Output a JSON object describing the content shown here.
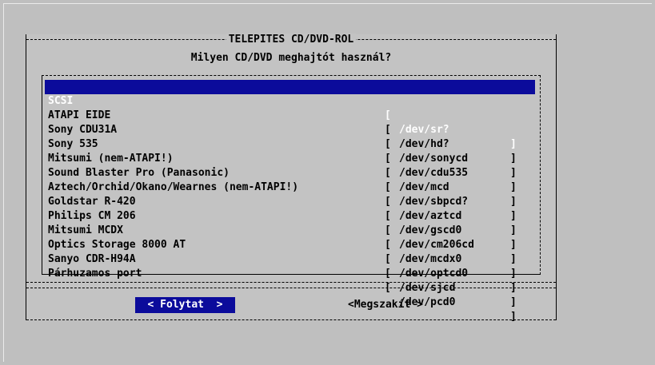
{
  "dialog": {
    "title": "TELEPITES CD/DVD-ROL",
    "question": "Milyen CD/DVD meghajtót használ?"
  },
  "drives": [
    {
      "name": "SCSI",
      "device": "/dev/sr?"
    },
    {
      "name": "ATAPI EIDE",
      "device": "/dev/hd?"
    },
    {
      "name": "Sony CDU31A",
      "device": "/dev/sonycd"
    },
    {
      "name": "Sony 535",
      "device": "/dev/cdu535"
    },
    {
      "name": "Mitsumi (nem-ATAPI!)",
      "device": "/dev/mcd"
    },
    {
      "name": "Sound Blaster Pro (Panasonic)",
      "device": "/dev/sbpcd?"
    },
    {
      "name": "Aztech/Orchid/Okano/Wearnes (nem-ATAPI!)",
      "device": "/dev/aztcd"
    },
    {
      "name": "Goldstar R-420",
      "device": "/dev/gscd0"
    },
    {
      "name": "Philips CM 206",
      "device": "/dev/cm206cd"
    },
    {
      "name": "Mitsumi MCDX",
      "device": "/dev/mcdx0"
    },
    {
      "name": "Optics Storage 8000 AT",
      "device": "/dev/optcd0"
    },
    {
      "name": "Sanyo CDR-H94A",
      "device": "/dev/sjcd"
    },
    {
      "name": "Párhuzamos port",
      "device": "/dev/pcd0"
    }
  ],
  "brackets": {
    "open": "[",
    "close": "]"
  },
  "buttons": {
    "continue": "< Folytat  >",
    "cancel": "<Megszakít >"
  },
  "colors": {
    "background": "#bfbfbf",
    "dialog": "#c3c3c3",
    "highlight": "#0b0b9b",
    "highlight_text": "#ffffff"
  }
}
